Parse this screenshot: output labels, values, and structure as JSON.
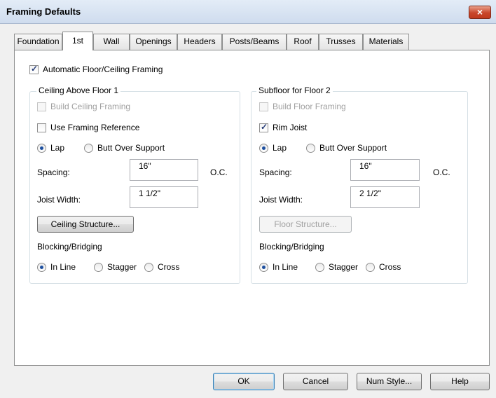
{
  "window": {
    "title": "Framing Defaults",
    "close_symbol": "×"
  },
  "tabs": [
    {
      "label": "Foundation",
      "active": false
    },
    {
      "label": "1st",
      "active": true
    },
    {
      "label": "Wall",
      "active": false
    },
    {
      "label": "Openings",
      "active": false
    },
    {
      "label": "Headers",
      "active": false
    },
    {
      "label": "Posts/Beams",
      "active": false
    },
    {
      "label": "Roof",
      "active": false
    },
    {
      "label": "Trusses",
      "active": false
    },
    {
      "label": "Materials",
      "active": false
    }
  ],
  "auto_framing": {
    "label": "Automatic Floor/Ceiling Framing",
    "checked": true
  },
  "ceiling": {
    "title": "Ceiling Above Floor 1",
    "build": {
      "label": "Build Ceiling Framing",
      "checked": false,
      "enabled": false
    },
    "reference": {
      "label": "Use Framing Reference",
      "checked": false
    },
    "lap_label": "Lap",
    "butt_label": "Butt Over Support",
    "spacing_label": "Spacing:",
    "spacing_value": "16\"",
    "oc_label": "O.C.",
    "joist_label": "Joist Width:",
    "joist_value": "1 1/2\"",
    "structure_button": "Ceiling Structure...",
    "blocking_label": "Blocking/Bridging",
    "inline_label": "In Line",
    "stagger_label": "Stagger",
    "cross_label": "Cross"
  },
  "subfloor": {
    "title": "Subfloor for Floor 2",
    "build": {
      "label": "Build Floor Framing",
      "checked": false,
      "enabled": false
    },
    "rim": {
      "label": "Rim Joist",
      "checked": true
    },
    "lap_label": "Lap",
    "butt_label": "Butt Over Support",
    "spacing_label": "Spacing:",
    "spacing_value": "16\"",
    "oc_label": "O.C.",
    "joist_label": "Joist Width:",
    "joist_value": "2 1/2\"",
    "structure_button": "Floor Structure...",
    "blocking_label": "Blocking/Bridging",
    "inline_label": "In Line",
    "stagger_label": "Stagger",
    "cross_label": "Cross"
  },
  "buttons": {
    "ok": "OK",
    "cancel": "Cancel",
    "num_style": "Num Style...",
    "help": "Help"
  },
  "check_mark": "✓"
}
